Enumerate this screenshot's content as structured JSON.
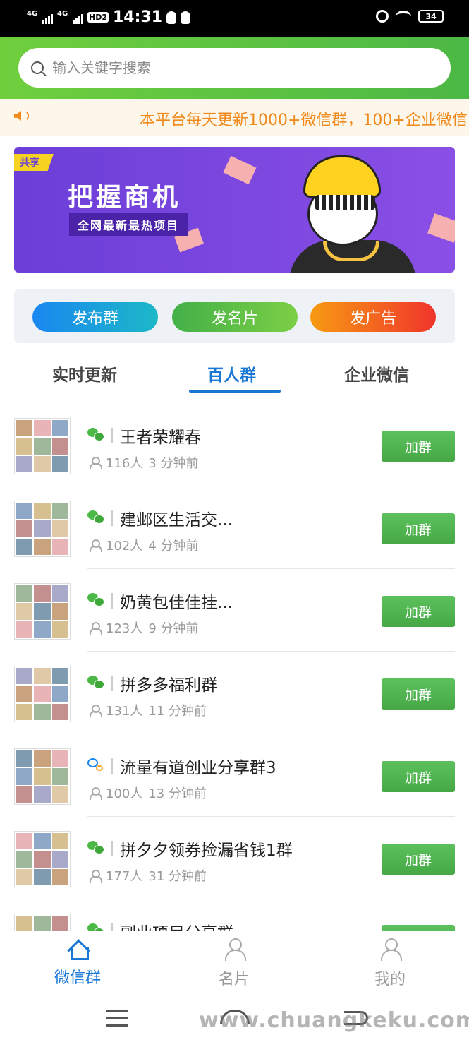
{
  "status_bar": {
    "signal1": "4G",
    "signal2": "4G",
    "hd": "HD2",
    "time": "14:31",
    "battery": "34"
  },
  "search": {
    "placeholder": "输入关键字搜索"
  },
  "notice": {
    "text": "本平台每天更新1000+微信群，100+企业微信"
  },
  "banner": {
    "tag": "共享",
    "title": "把握商机",
    "subtitle": "全网最新最热项目"
  },
  "actions": [
    {
      "label": "发布群"
    },
    {
      "label": "发名片"
    },
    {
      "label": "发广告"
    }
  ],
  "tabs": [
    {
      "label": "实时更新"
    },
    {
      "label": "百人群"
    },
    {
      "label": "企业微信"
    }
  ],
  "active_tab": "百人群",
  "groups": [
    {
      "name": "王者荣耀春",
      "members": "116人",
      "time": "3 分钟前",
      "icon": "wechat-icon",
      "button": "加群"
    },
    {
      "name": "建邺区生活交...",
      "members": "102人",
      "time": "4 分钟前",
      "icon": "wechat-icon",
      "button": "加群"
    },
    {
      "name": "奶黄包佳佳挂...",
      "members": "123人",
      "time": "9 分钟前",
      "icon": "wechat-icon",
      "button": "加群"
    },
    {
      "name": "拼多多福利群",
      "members": "131人",
      "time": "11 分钟前",
      "icon": "wechat-icon",
      "button": "加群"
    },
    {
      "name": "流量有道创业分享群3",
      "members": "100人",
      "time": "13 分钟前",
      "icon": "qq-chat-icon",
      "button": "加群"
    },
    {
      "name": "拼夕夕领券捡漏省钱1群",
      "members": "177人",
      "time": "31 分钟前",
      "icon": "wechat-icon",
      "button": "加群"
    },
    {
      "name": "副业项目分享群",
      "members": "",
      "time": "",
      "icon": "wechat-icon",
      "button": ""
    }
  ],
  "bottom_nav": [
    {
      "label": "微信群",
      "icon": "home-icon",
      "active": true
    },
    {
      "label": "名片",
      "icon": "user-add-icon",
      "active": false
    },
    {
      "label": "我的",
      "icon": "user-icon",
      "active": false
    }
  ],
  "watermark": "www.chuangkeku.com",
  "colors": {
    "brand_green": "#4cb845",
    "accent_blue": "#1977d6",
    "notice_orange": "#f08a1c",
    "banner_purple": "#6b3fd8"
  }
}
